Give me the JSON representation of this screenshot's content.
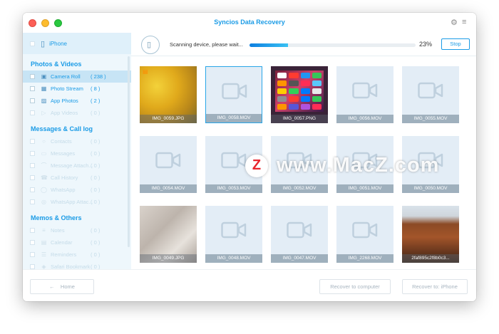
{
  "window": {
    "title": "Syncios Data Recovery"
  },
  "sidebar": {
    "device": "iPhone",
    "sections": [
      {
        "title": "Photos & Videos",
        "items": [
          {
            "label": "Camera Roll",
            "count": "( 238 )",
            "icon": "camera-icon",
            "active": true,
            "enabled": true
          },
          {
            "label": "Photo Stream",
            "count": "( 8 )",
            "icon": "photo-stream-icon",
            "active": false,
            "enabled": true
          },
          {
            "label": "App Photos",
            "count": "( 2 )",
            "icon": "app-photos-icon",
            "active": false,
            "enabled": true
          },
          {
            "label": "App Videos",
            "count": "( 0 )",
            "icon": "app-videos-icon",
            "active": false,
            "enabled": false
          }
        ]
      },
      {
        "title": "Messages & Call log",
        "items": [
          {
            "label": "Contacts",
            "count": "( 0 )",
            "icon": "contacts-icon",
            "enabled": false
          },
          {
            "label": "Messages",
            "count": "( 0 )",
            "icon": "messages-icon",
            "enabled": false
          },
          {
            "label": "Message Attach...",
            "count": "( 0 )",
            "icon": "attachment-icon",
            "enabled": false
          },
          {
            "label": "Call History",
            "count": "( 0 )",
            "icon": "phone-icon",
            "enabled": false
          },
          {
            "label": "WhatsApp",
            "count": "( 0 )",
            "icon": "whatsapp-icon",
            "enabled": false
          },
          {
            "label": "WhatsApp Attac...",
            "count": "( 0 )",
            "icon": "whatsapp-attachment-icon",
            "enabled": false
          }
        ]
      },
      {
        "title": "Memos & Others",
        "items": [
          {
            "label": "Notes",
            "count": "( 0 )",
            "icon": "notes-icon",
            "enabled": false
          },
          {
            "label": "Calendar",
            "count": "( 0 )",
            "icon": "calendar-icon",
            "enabled": false
          },
          {
            "label": "Reminders",
            "count": "( 0 )",
            "icon": "reminders-icon",
            "enabled": false
          },
          {
            "label": "Safari Bookmark",
            "count": "( 0 )",
            "icon": "bookmark-icon",
            "enabled": false
          }
        ]
      }
    ]
  },
  "scan": {
    "status": "Scanning device, please wait...",
    "percent_label": "23%",
    "progress": 0.23,
    "stop_label": "Stop"
  },
  "tiles": [
    {
      "name": "IMG_0059.JPG",
      "kind": "photo-yellow",
      "trash": true
    },
    {
      "name": "IMG_0058.MOV",
      "kind": "video",
      "selected": true
    },
    {
      "name": "IMG_0057.PNG",
      "kind": "photo-ios"
    },
    {
      "name": "IMG_0056.MOV",
      "kind": "video"
    },
    {
      "name": "IMG_0055.MOV",
      "kind": "video"
    },
    {
      "name": "IMG_0054.MOV",
      "kind": "video"
    },
    {
      "name": "IMG_0053.MOV",
      "kind": "video"
    },
    {
      "name": "IMG_0052.MOV",
      "kind": "video"
    },
    {
      "name": "IMG_0051.MOV",
      "kind": "video"
    },
    {
      "name": "IMG_0050.MOV",
      "kind": "video"
    },
    {
      "name": "IMG_0049.JPG",
      "kind": "photo-blur"
    },
    {
      "name": "IMG_0048.MOV",
      "kind": "video"
    },
    {
      "name": "IMG_0047.MOV",
      "kind": "video"
    },
    {
      "name": "IMG_2268.MOV",
      "kind": "video"
    },
    {
      "name": "2faf895c2f8b0c3...",
      "kind": "photo-forest"
    }
  ],
  "footer": {
    "home_label": "Home",
    "recover_computer_label": "Recover to computer",
    "recover_device_label": "Recover to: iPhone"
  },
  "watermark": {
    "logo_letter": "Z",
    "text": "www.MacZ.com"
  },
  "colors": {
    "accent": "#1a9be6",
    "sidebar_bg": "#eef7fc",
    "active_item_bg": "#c7e4f5",
    "warning": "#ff8a00"
  }
}
